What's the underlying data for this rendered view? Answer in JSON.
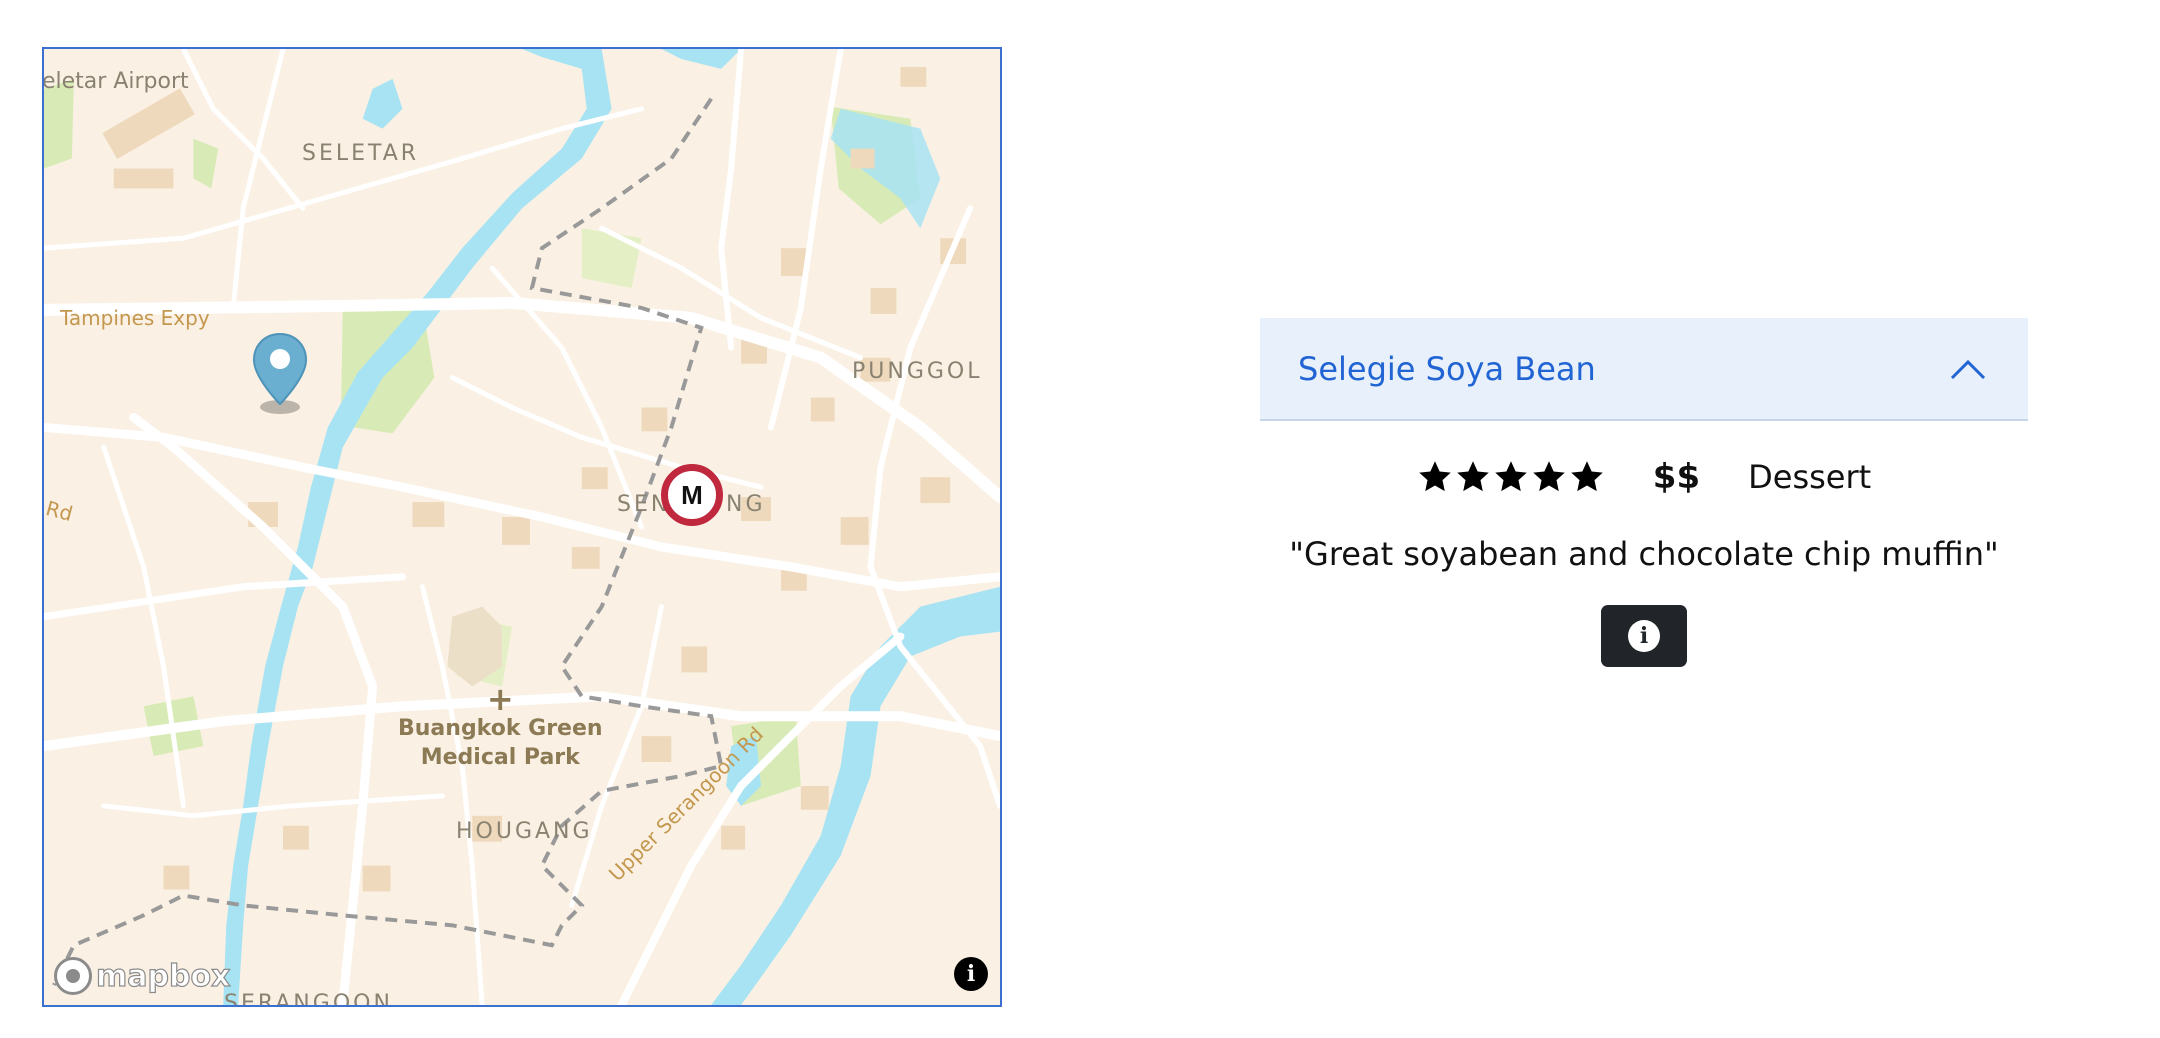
{
  "map": {
    "labels": {
      "seletar_airport": "eletar Airport",
      "seletar": "SELETAR",
      "punggol": "PUNGGOL",
      "sengkang_left": "SEN",
      "sengkang_right": "NG",
      "hougang": "HOUGANG",
      "serangoon": "SERANGOON",
      "tampines_expy": "Tampines Expy",
      "rd": "Rd",
      "upper_serangoon_rd": "Upper Serangoon Rd",
      "park_line1": "Buangkok Green",
      "park_line2": "Medical Park"
    },
    "metro_letter": "M",
    "attribution_logo": "mapbox",
    "attribution_button": "i",
    "colors": {
      "land": "#faf1e4",
      "water": "#a8e3f3",
      "park": "#d8ebb6",
      "building": "#efd9bd",
      "road": "#ffffff",
      "pin": "#6aaed0",
      "metro": "#c0283d"
    }
  },
  "card": {
    "title": "Selegie Soya Bean",
    "rating_stars": 5,
    "price": "$$",
    "category": "Dessert",
    "review": "\"Great soyabean and chocolate chip muffin\"",
    "info_icon": "i"
  }
}
